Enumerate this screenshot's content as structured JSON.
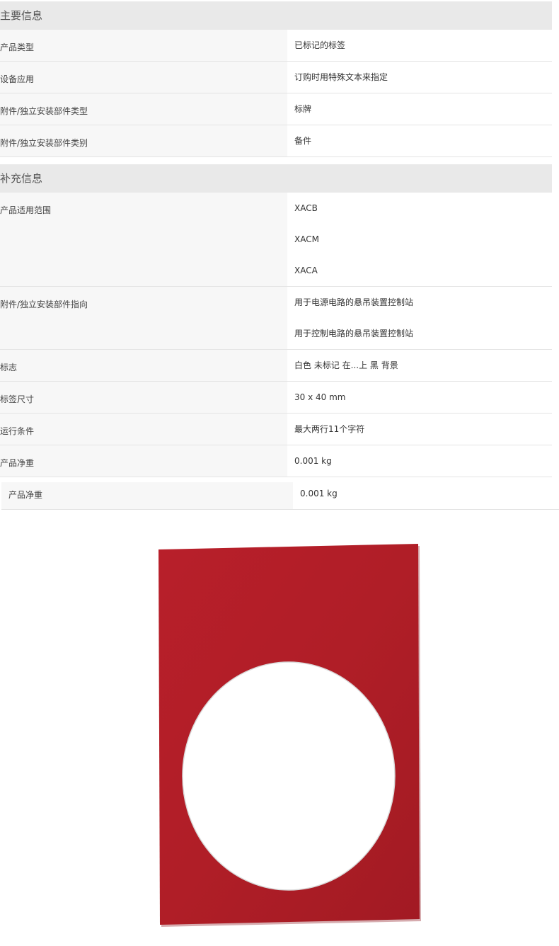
{
  "main_info": {
    "title": "主要信息",
    "rows": [
      {
        "label": "产品类型",
        "values": [
          "已标记的标签"
        ]
      },
      {
        "label": "设备应用",
        "values": [
          "订购时用特殊文本来指定"
        ]
      },
      {
        "label": "附件/独立安装部件类型",
        "values": [
          "标牌"
        ]
      },
      {
        "label": "附件/独立安装部件类别",
        "values": [
          "备件"
        ]
      }
    ]
  },
  "extra_info": {
    "title": "补充信息",
    "rows": [
      {
        "label": "产品适用范围",
        "values": [
          "XACB",
          "XACM",
          "XACA"
        ]
      },
      {
        "label": "附件/独立安装部件指向",
        "values": [
          "用于电源电路的悬吊装置控制站",
          "用于控制电路的悬吊装置控制站"
        ]
      },
      {
        "label": "标志",
        "values": [
          "白色 未标记 在...上 黑 背景"
        ]
      },
      {
        "label": "标签尺寸",
        "values": [
          "30 x 40 mm"
        ]
      },
      {
        "label": "运行条件",
        "values": [
          "最大两行11个字符"
        ]
      },
      {
        "label": "产品净重",
        "values": [
          "0.001 kg"
        ]
      }
    ]
  },
  "weight_row": {
    "label": "产品净重",
    "value": "0.001 kg"
  },
  "product_image": {
    "plate_color": "#b01e27",
    "hole_color": "#ffffff"
  }
}
